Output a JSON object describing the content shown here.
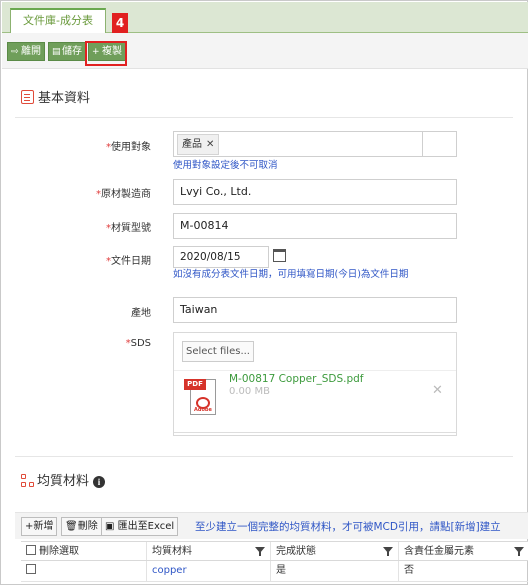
{
  "tab": {
    "label": "文件庫-成分表"
  },
  "annotation": {
    "step": "4"
  },
  "toolbar": {
    "back_label": "離開",
    "save_label": "儲存",
    "copy_label": "複製"
  },
  "basic_section": {
    "title": "基本資料"
  },
  "fields": {
    "usage_target": {
      "label": "使用對象",
      "chip": "產品",
      "hint": "使用對象設定後不可取消"
    },
    "manufacturer": {
      "label": "原材製造商",
      "value": "Lvyi Co., Ltd."
    },
    "material_no": {
      "label": "材質型號",
      "value": "M-00814"
    },
    "doc_date": {
      "label": "文件日期",
      "value": "2020/08/15",
      "hint": "如沒有成分表文件日期，可用填寫日期(今日)為文件日期"
    },
    "origin": {
      "label": "產地",
      "value": "Taiwan"
    },
    "sds": {
      "label": "SDS",
      "select_label": "Select files...",
      "file_name": "M-00817 Copper_SDS.pdf",
      "file_size": "0.00 MB",
      "pdf_badge": "PDF",
      "pdf_brand": "Adobe"
    }
  },
  "homogeneous_section": {
    "title": "均質材料",
    "info": "i",
    "add_label": "新增",
    "delete_label": "刪除",
    "export_label": "匯出至Excel",
    "note": "至少建立一個完整的均質材料，才可被MCD引用，請點[新增]建立",
    "columns": [
      "刪除選取",
      "均質材料",
      "完成狀態",
      "含責任金屬元素"
    ],
    "rows": [
      {
        "material": "copper",
        "status": "是",
        "metal": "否"
      }
    ]
  },
  "colors": {
    "accent_green": "#6f9e5a",
    "required_red": "#e03c3c",
    "link_blue": "#2f56c6",
    "annotation_red": "#e12020"
  }
}
